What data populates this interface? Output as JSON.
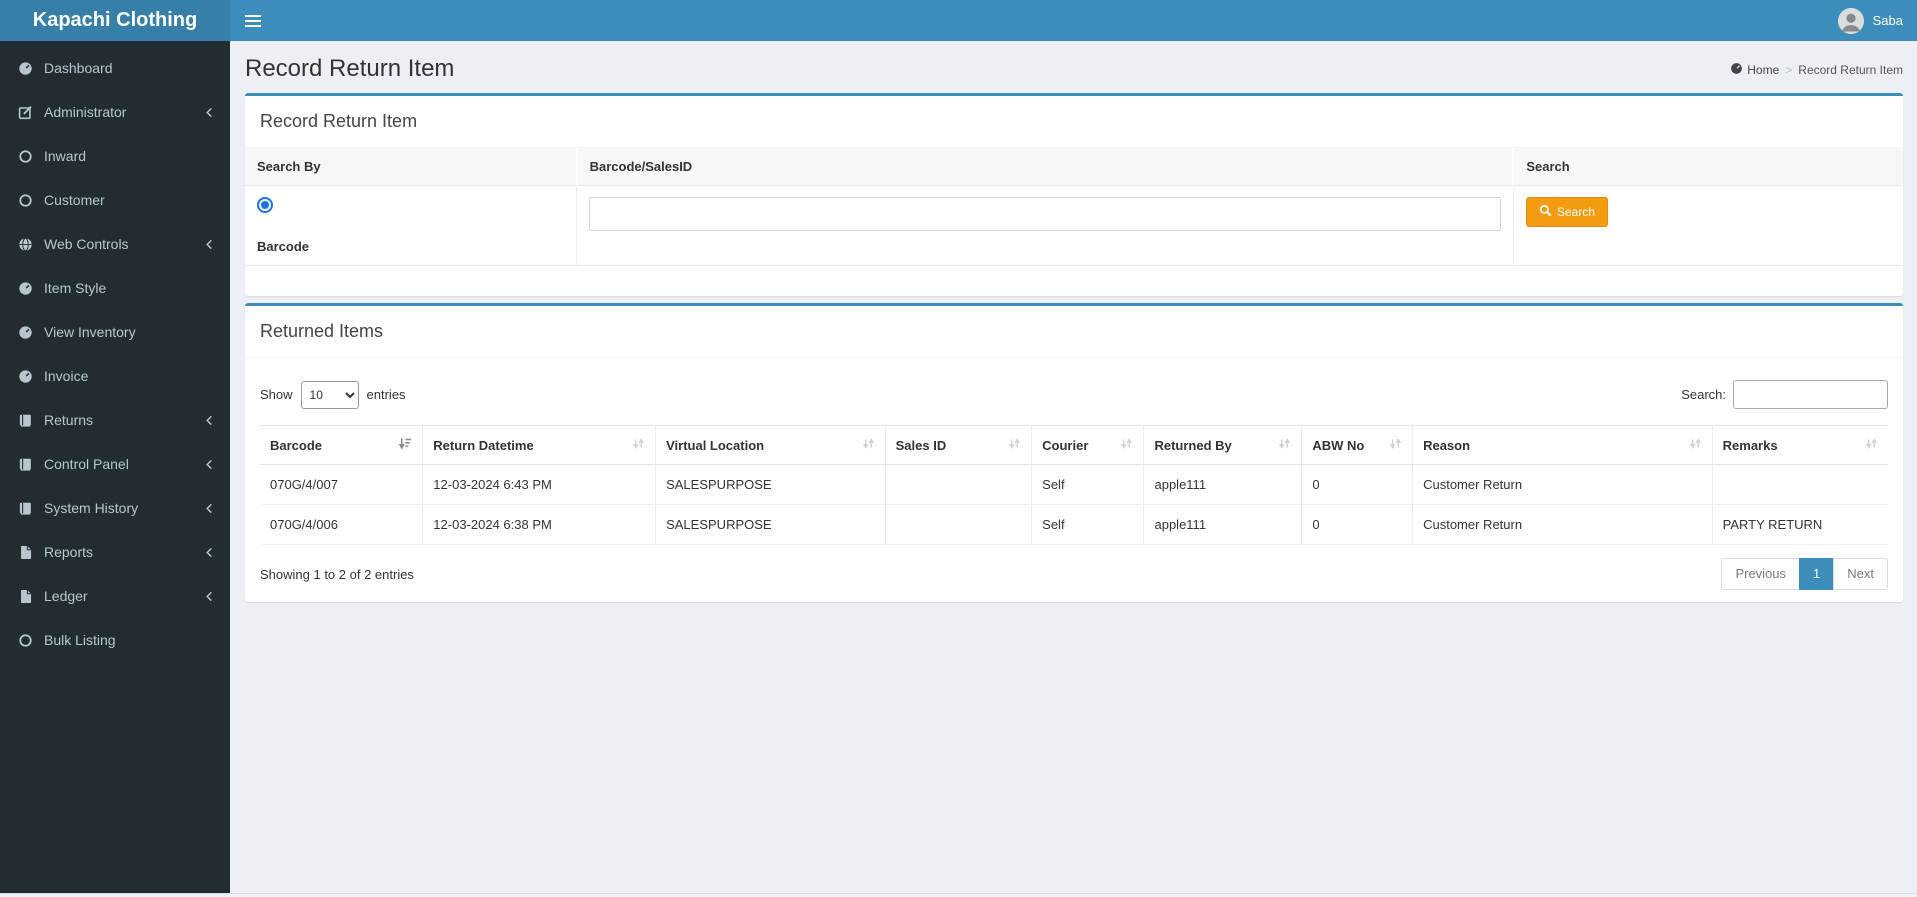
{
  "brand": "Kapachi Clothing",
  "navbar": {
    "user_name": "Saba"
  },
  "sidebar": {
    "items": [
      {
        "label": "Dashboard",
        "icon": "tachometer",
        "has_submenu": false
      },
      {
        "label": "Administrator",
        "icon": "pencil-square",
        "has_submenu": true
      },
      {
        "label": "Inward",
        "icon": "circle-o",
        "has_submenu": false
      },
      {
        "label": "Customer",
        "icon": "circle-o",
        "has_submenu": false
      },
      {
        "label": "Web Controls",
        "icon": "globe",
        "has_submenu": true
      },
      {
        "label": "Item Style",
        "icon": "tachometer",
        "has_submenu": false
      },
      {
        "label": "View Inventory",
        "icon": "tachometer",
        "has_submenu": false
      },
      {
        "label": "Invoice",
        "icon": "tachometer",
        "has_submenu": false
      },
      {
        "label": "Returns",
        "icon": "book",
        "has_submenu": true
      },
      {
        "label": "Control Panel",
        "icon": "book",
        "has_submenu": true
      },
      {
        "label": "System History",
        "icon": "book",
        "has_submenu": true
      },
      {
        "label": "Reports",
        "icon": "file",
        "has_submenu": true
      },
      {
        "label": "Ledger",
        "icon": "file",
        "has_submenu": true
      },
      {
        "label": "Bulk Listing",
        "icon": "circle-o",
        "has_submenu": false
      }
    ]
  },
  "page": {
    "title": "Record Return Item",
    "breadcrumb": {
      "home_label": "Home",
      "separator": ">",
      "current": "Record Return Item"
    }
  },
  "search_panel": {
    "title": "Record Return Item",
    "col_search_by": "Search By",
    "col_barcode_salesid": "Barcode/SalesID",
    "col_search": "Search",
    "radio_label": "Barcode",
    "barcode_input_value": "",
    "search_button_label": "Search"
  },
  "results_panel": {
    "title": "Returned Items",
    "length_menu": {
      "show_label": "Show",
      "selected": "10",
      "entries_label": "entries"
    },
    "search": {
      "label": "Search:",
      "value": ""
    },
    "table": {
      "columns": [
        {
          "label": "Barcode",
          "sort": "desc"
        },
        {
          "label": "Return Datetime",
          "sort": "both"
        },
        {
          "label": "Virtual Location",
          "sort": "both"
        },
        {
          "label": "Sales ID",
          "sort": "both"
        },
        {
          "label": "Courier",
          "sort": "both"
        },
        {
          "label": "Returned By",
          "sort": "both"
        },
        {
          "label": "ABW No",
          "sort": "both"
        },
        {
          "label": "Reason",
          "sort": "both"
        },
        {
          "label": "Remarks",
          "sort": "both"
        }
      ],
      "rows": [
        [
          "070G/4/007",
          "12-03-2024 6:43 PM",
          "SALESPURPOSE",
          "",
          "Self",
          "apple111",
          "0",
          "Customer Return",
          ""
        ],
        [
          "070G/4/006",
          "12-03-2024 6:38 PM",
          "SALESPURPOSE",
          "",
          "Self",
          "apple111",
          "0",
          "Customer Return",
          "PARTY RETURN"
        ]
      ]
    },
    "info": "Showing 1 to 2 of 2 entries",
    "pagination": {
      "previous_label": "Previous",
      "active_page": "1",
      "next_label": "Next"
    }
  },
  "colors": {
    "navbar": "#3c8dbc",
    "logo_bg": "#367fa9",
    "sidebar_bg": "#222d32",
    "sidebar_text": "#b8c7ce",
    "content_bg": "#ecf0f5",
    "box_accent": "#3c8dbc",
    "search_button": "#f39c12",
    "pagination_active": "#3c8dbc",
    "radio_accent": "#1a73e8"
  }
}
